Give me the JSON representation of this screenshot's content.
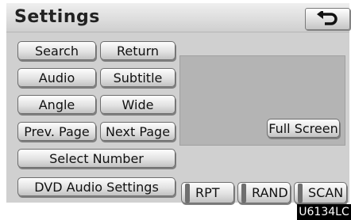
{
  "header": {
    "title": "Settings",
    "back_icon": "return-arrow-icon"
  },
  "buttons": {
    "search": "Search",
    "return": "Return",
    "audio": "Audio",
    "subtitle": "Subtitle",
    "angle": "Angle",
    "wide": "Wide",
    "prev_page": "Prev. Page",
    "next_page": "Next Page",
    "select_number": "Select Number",
    "dvd_audio_settings": "DVD Audio Settings",
    "full_screen": "Full Screen"
  },
  "playback": {
    "rpt": "RPT",
    "rand": "RAND",
    "scan": "SCAN"
  },
  "figure_code": "U6134LC"
}
